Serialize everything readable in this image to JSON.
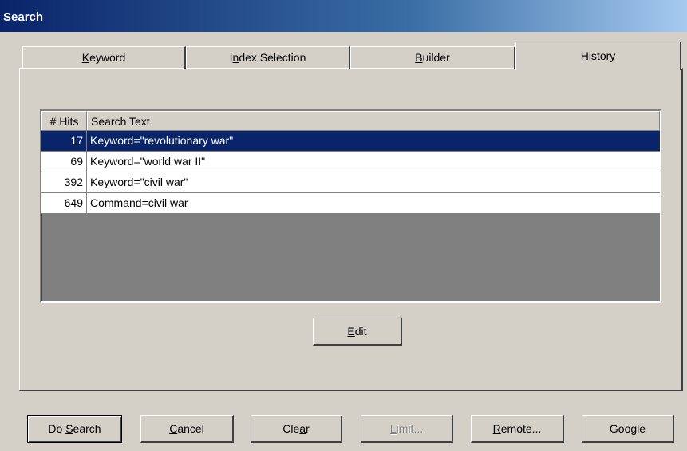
{
  "window": {
    "title": "Search"
  },
  "tabs": [
    {
      "pre": "",
      "key": "K",
      "post": "eyword",
      "active": false
    },
    {
      "pre": "I",
      "key": "n",
      "post": "dex Selection",
      "active": false
    },
    {
      "pre": "",
      "key": "B",
      "post": "uilder",
      "active": false
    },
    {
      "pre": "His",
      "key": "t",
      "post": "ory",
      "active": true
    }
  ],
  "history_table": {
    "headers": {
      "hits": "# Hits",
      "text": "Search Text"
    },
    "rows": [
      {
        "hits": "17",
        "text": "Keyword=\"revolutionary war\"",
        "selected": true
      },
      {
        "hits": "69",
        "text": "Keyword=\"world war II\"",
        "selected": false
      },
      {
        "hits": "392",
        "text": "Keyword=\"civil war\"",
        "selected": false
      },
      {
        "hits": "649",
        "text": "Command=civil war",
        "selected": false
      }
    ]
  },
  "edit_button": {
    "pre": "",
    "key": "E",
    "post": "dit"
  },
  "bottom_buttons": [
    {
      "pre": "Do ",
      "key": "S",
      "post": "earch"
    },
    {
      "pre": "",
      "key": "C",
      "post": "ancel"
    },
    {
      "pre": "Cle",
      "key": "a",
      "post": "r"
    },
    {
      "pre": "",
      "key": "L",
      "post": "imit..."
    },
    {
      "pre": "",
      "key": "R",
      "post": "emote..."
    },
    {
      "pre": "Google",
      "key": "",
      "post": ""
    }
  ],
  "colors": {
    "face": "#d4d0c8",
    "selection": "#0a246a",
    "title_gradient_start": "#0a246a",
    "title_gradient_end": "#a6caf0"
  }
}
